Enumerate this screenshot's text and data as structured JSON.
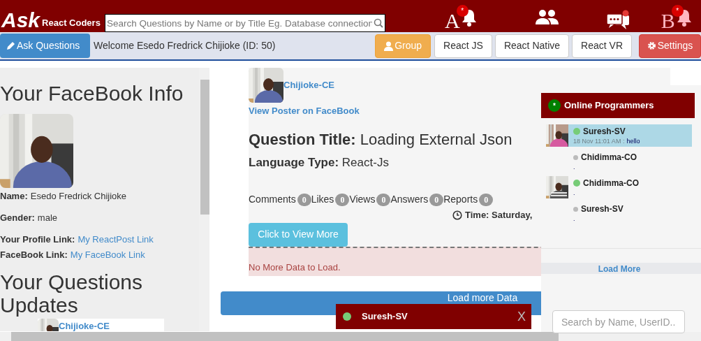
{
  "header": {
    "logo": "Ask",
    "subtitle": "React Coders",
    "search": {
      "placeholder": "Search Questions by Name or by Title Eg. Database connection"
    },
    "icons": [
      {
        "kind": "letter-bell",
        "letter": "A",
        "badge": "*"
      },
      {
        "kind": "people"
      },
      {
        "kind": "chat"
      },
      {
        "kind": "letter-bell",
        "letter": "B",
        "badge": "*"
      }
    ]
  },
  "nav": {
    "ask_button": "Ask Questions",
    "welcome": "Welcome Esedo Fredrick Chijioke (ID: 50)",
    "tabs": [
      {
        "label": "Group",
        "kind": "warning"
      },
      {
        "label": "React JS",
        "kind": "default"
      },
      {
        "label": "React Native",
        "kind": "default"
      },
      {
        "label": "React VR",
        "kind": "default"
      },
      {
        "label": "Settings",
        "kind": "danger"
      }
    ]
  },
  "sidebar": {
    "title": "Your FaceBook Info",
    "fields": [
      {
        "label": "Name:",
        "value": "Esedo Fredrick Chijioke"
      },
      {
        "label": "Gender:",
        "value": "male"
      },
      {
        "label": "Your Profile Link:",
        "link": "My ReactPost Link"
      },
      {
        "label": "FaceBook Link:",
        "link": "My FaceBook Link"
      }
    ],
    "updates_title": "Your Questions Updates",
    "update_preview": {
      "name": "Chijioke-CE"
    }
  },
  "post": {
    "author": "Chijioke-CE",
    "poster_link": "View Poster on FaceBook",
    "title": "**Question Title:** Loading External Json",
    "language": "**Language Type:** React-Js",
    "stats": [
      {
        "label": "Comments",
        "count": "0"
      },
      {
        "label": "Likes",
        "count": "0"
      },
      {
        "label": "Views",
        "count": "0"
      },
      {
        "label": "Answers",
        "count": "0"
      },
      {
        "label": "Reports",
        "count": "0"
      }
    ],
    "time": "Time: Saturday,",
    "view_more": "Click to View More",
    "no_more": "No More Data to Load.",
    "load_more": "Load more Data"
  },
  "chat": {
    "title": "Online Programmers",
    "badge": "*",
    "users": [
      {
        "name": "Suresh-SV",
        "online": true,
        "selected": true,
        "time": "18 Nov 11:01 AM :",
        "message": "hello"
      },
      {
        "name": "Chidimma-CO",
        "online": false,
        "selected": false,
        "message": "."
      },
      {
        "name": "Chidimma-CO",
        "online": true,
        "selected": false,
        "message": "."
      },
      {
        "name": "Suresh-SV",
        "online": false,
        "selected": false,
        "message": "."
      }
    ],
    "load_more": "Load More",
    "search": {
      "placeholder": "Search by Name, UserID.."
    }
  },
  "popup": {
    "name": "Suresh-SV",
    "online": true,
    "close": "X"
  }
}
